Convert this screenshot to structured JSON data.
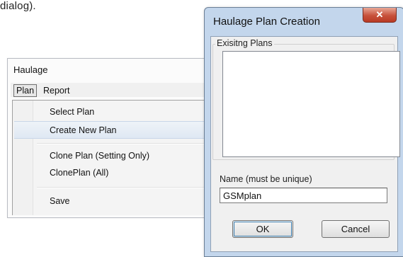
{
  "corner_text": "dialog).",
  "haulage_menu": {
    "title": "Haulage",
    "menubar": [
      "Plan",
      "Report"
    ],
    "items": [
      {
        "label": "Select Plan"
      },
      {
        "label": "Create New Plan",
        "highlighted": true
      },
      {
        "label": "Clone Plan (Setting Only)"
      },
      {
        "label": "ClonePlan (All)"
      },
      {
        "label": "Save"
      }
    ]
  },
  "dialog": {
    "title": "Haulage Plan Creation",
    "close_glyph": "✕",
    "existing_plans_label": "Exisitng Plans",
    "existing_plans": [],
    "name_label": "Name (must be unique)",
    "name_value": "GSMplan",
    "ok_label": "OK",
    "cancel_label": "Cancel"
  },
  "colors": {
    "dialog_frame": "#c3d6ec",
    "close_button": "#c7513b",
    "menu_highlight": "#dfe8f3"
  }
}
